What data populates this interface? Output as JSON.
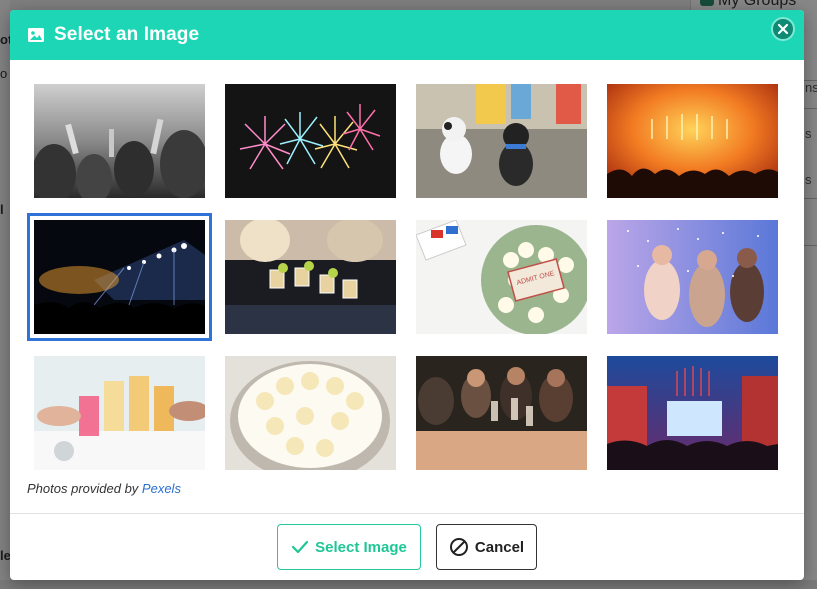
{
  "dialog": {
    "title": "Select an Image",
    "title_icon": "image-icon",
    "close_icon": "close-icon"
  },
  "images": [
    {
      "name": "concert-crowd-bw",
      "selected": false
    },
    {
      "name": "fireworks",
      "selected": false
    },
    {
      "name": "french-bulldogs",
      "selected": false
    },
    {
      "name": "concert-orange-stage",
      "selected": false
    },
    {
      "name": "concert-night-stage",
      "selected": true
    },
    {
      "name": "party-shots",
      "selected": false
    },
    {
      "name": "popcorn-3d-glasses-ticket",
      "selected": false
    },
    {
      "name": "party-confetti",
      "selected": false
    },
    {
      "name": "cocktail-toast",
      "selected": false
    },
    {
      "name": "popcorn-bowl",
      "selected": false
    },
    {
      "name": "friends-dinner-toast",
      "selected": false
    },
    {
      "name": "festival-stage",
      "selected": false
    }
  ],
  "credit": {
    "prefix": "Photos provided by",
    "link_text": "Pexels"
  },
  "buttons": {
    "select_label": "Select Image",
    "select_icon": "checkmark-icon",
    "cancel_label": "Cancel",
    "cancel_icon": "no-entry-icon"
  },
  "background": {
    "groups_label": "My Groups",
    "right_fragments": [
      "ns",
      "s",
      "s"
    ],
    "left_fragments": [
      "ot",
      "o",
      "l",
      "le"
    ]
  },
  "colors": {
    "header": "#1dd6b5",
    "selected_outline": "#2f72d8",
    "select_button": "#1fc796",
    "link": "#2a6fcf"
  }
}
